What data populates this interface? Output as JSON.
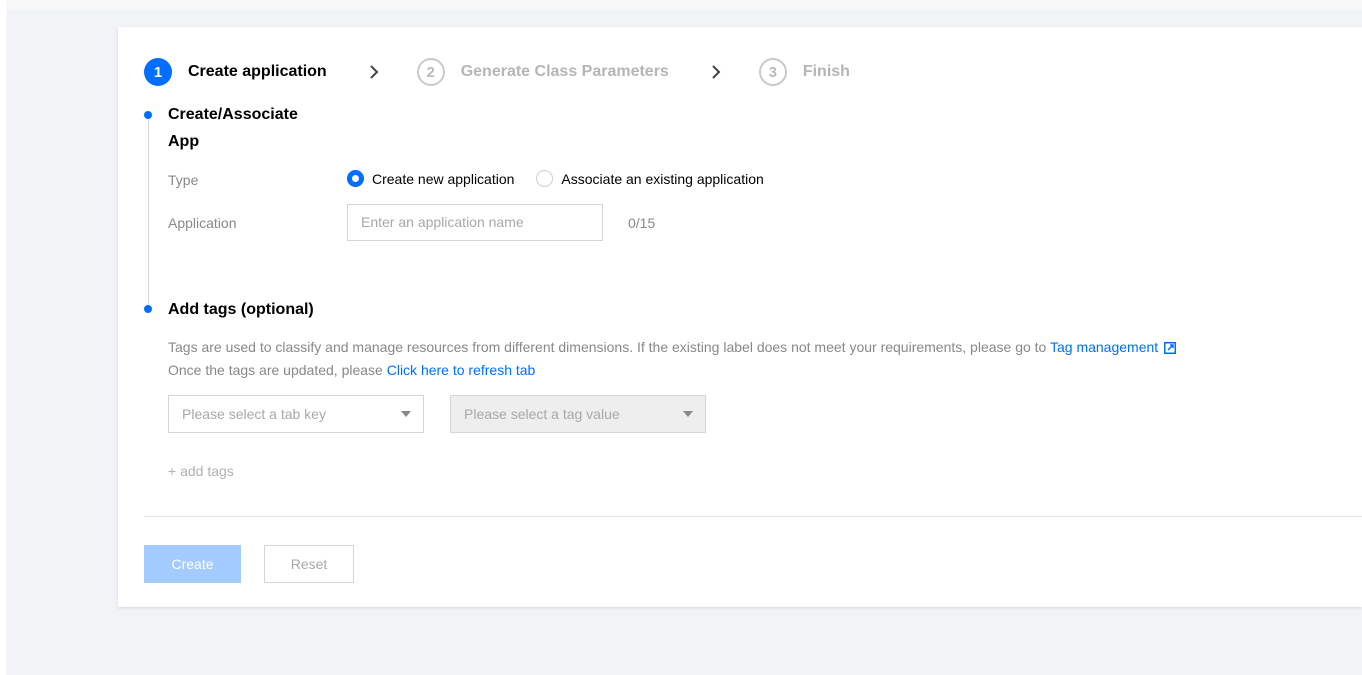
{
  "steps": [
    {
      "num": "1",
      "label": "Create application",
      "state": "active"
    },
    {
      "num": "2",
      "label": "Generate Class Parameters",
      "state": "inactive"
    },
    {
      "num": "3",
      "label": "Finish",
      "state": "inactive"
    }
  ],
  "section_app": {
    "title_line1": "Create/Associate",
    "title_line2": "App",
    "type_label": "Type",
    "radio_new": "Create new application",
    "radio_existing": "Associate an existing application",
    "selected": "Create new application",
    "application_label": "Application",
    "application_placeholder": "Enter an application name",
    "application_value": "",
    "counter": "0/15"
  },
  "section_tags": {
    "title": "Add tags (optional)",
    "desc_line1": "Tags are used to classify and manage resources from different dimensions. If the existing label does not meet your requirements, please go to",
    "tag_management_link": "Tag management",
    "desc_line2": "Once the tags are updated, please",
    "refresh_link": "Click here to refresh tab",
    "tag_key_placeholder": "Please select a tab key",
    "tag_value_placeholder": "Please select a tag value",
    "add_tags": "+ add tags"
  },
  "footer": {
    "create_label": "Create",
    "reset_label": "Reset"
  },
  "colors": {
    "accent": "#006eff",
    "create_disabled": "#a3cbff"
  },
  "icons": {
    "step_chevron": "chevron-right-icon",
    "external_link": "external-link-icon",
    "dropdown": "caret-down-icon"
  }
}
